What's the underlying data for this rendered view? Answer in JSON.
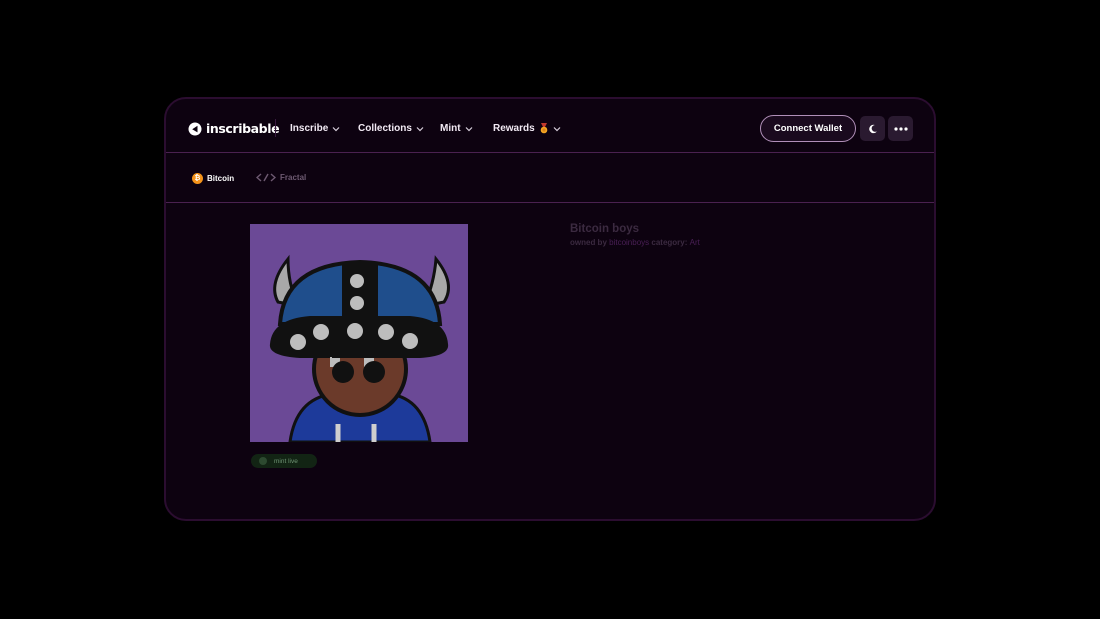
{
  "brand": {
    "name": "inscribable",
    "icon": "logo-arrow-icon"
  },
  "nav": {
    "inscribe": "Inscribe",
    "collections": "Collections",
    "mint": "Mint",
    "rewards": "Rewards"
  },
  "header": {
    "connect_wallet": "Connect Wallet",
    "theme_icon": "moon-icon",
    "more_icon": "more-dots-icon"
  },
  "chains": {
    "bitcoin": "Bitcoin",
    "fractal": "Fractal"
  },
  "collection": {
    "title": "Bitcoin boys",
    "owned_by_label": "owned by",
    "owner": "bitcoinboys",
    "category_label": "category:",
    "category": "Art",
    "status": "mint live"
  },
  "colors": {
    "background": "#0d0210",
    "accent_border": "#4a2150",
    "bitcoin_orange": "#f4931a",
    "art_background": "#6b4996"
  }
}
